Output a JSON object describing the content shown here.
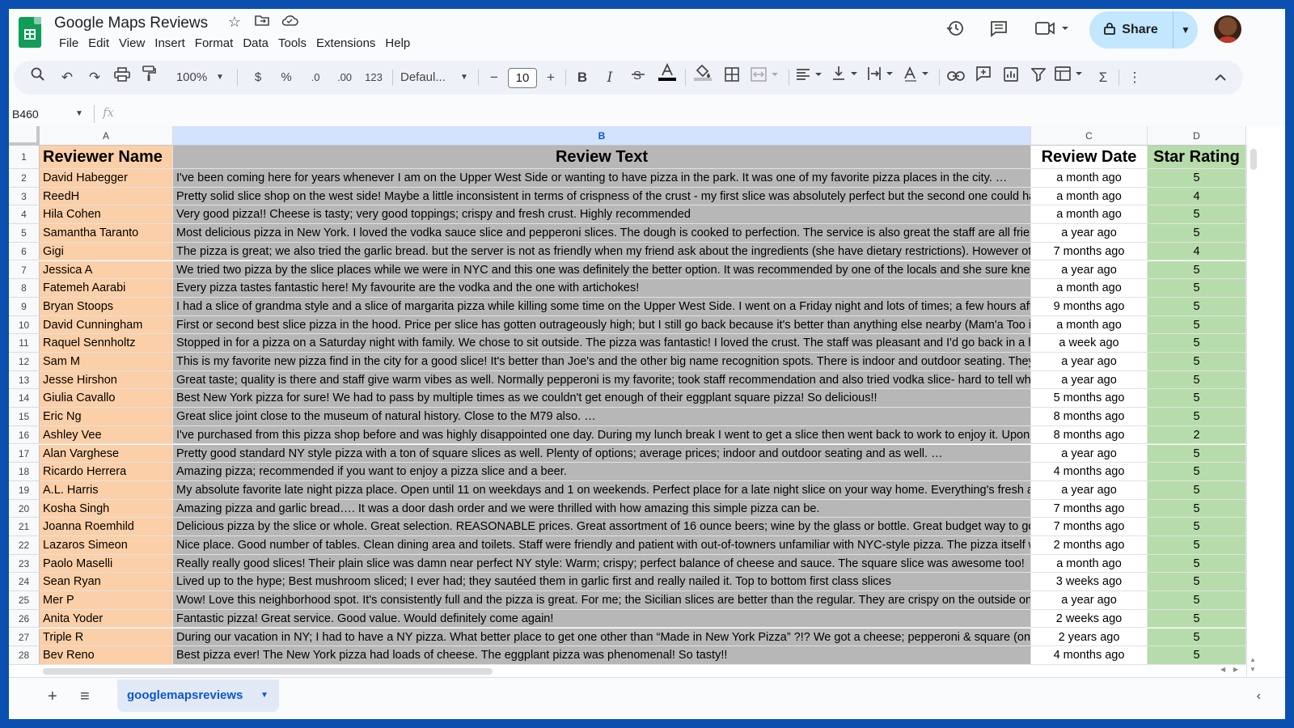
{
  "app": {
    "title": "Google Maps Reviews",
    "menu": [
      "File",
      "Edit",
      "View",
      "Insert",
      "Format",
      "Data",
      "Tools",
      "Extensions",
      "Help"
    ],
    "share_label": "Share",
    "icons": {
      "star": "star-icon",
      "folder": "move-folder-icon",
      "cloud": "cloud-saved-icon",
      "history": "history-icon",
      "comments": "comments-icon",
      "meet": "meet-icon"
    }
  },
  "toolbar": {
    "zoom": "100%",
    "currency": "$",
    "percent": "%",
    "decrease_decimals": ".0",
    "increase_decimals": ".00",
    "number_format": "123",
    "font": "Defaul...",
    "font_size": "10",
    "bold": "B",
    "italic": "I"
  },
  "formula_bar": {
    "cell_ref": "B460",
    "fx": "fx",
    "formula": ""
  },
  "columns": [
    "A",
    "B",
    "C",
    "D"
  ],
  "selected_column": "B",
  "headers": [
    "Reviewer Name",
    "Review Text",
    "Review Date",
    "Star Rating"
  ],
  "rows": [
    [
      "David Habegger",
      "I've been coming here for years whenever I am on the Upper West Side or wanting to have pizza in the park. It was one of my favorite pizza places in the city. …",
      "a month ago",
      "5"
    ],
    [
      "ReedH",
      "Pretty solid slice shop on the west side! Maybe a little inconsistent in terms of crispness of the crust - my first slice was absolutely perfect but the second one could ha",
      "a month ago",
      "4"
    ],
    [
      "Hila Cohen",
      "Very good pizza!! Cheese is tasty; very good toppings; crispy and fresh crust. Highly recommended",
      "a month ago",
      "5"
    ],
    [
      "Samantha Taranto",
      "Most delicious pizza in New York. I loved the vodka sauce slice and pepperoni slices. The dough is cooked to perfection. The service is also great the staff are all frien",
      "a year ago",
      "5"
    ],
    [
      "Gigi",
      "The pizza is great; we also tried the garlic bread. but the server is not as friendly when my friend ask about the ingredients (she have dietary restrictions). However oth",
      "7 months ago",
      "4"
    ],
    [
      "Jessica A",
      "We tried two pizza by the slice places while we were in NYC and this one was definitely the better option. It was recommended by one of the locals and she sure knew",
      "a year ago",
      "5"
    ],
    [
      "Fatemeh Aarabi",
      "Every pizza tastes fantastic here! My favourite are the vodka and the one with artichokes!",
      "a month ago",
      "5"
    ],
    [
      "Bryan Stoops",
      "I had a slice of grandma style and a slice of margarita pizza while killing some time on the Upper West Side. I went on a Friday night and lots of times; a few hours afte",
      "9 months ago",
      "5"
    ],
    [
      "David Cunningham",
      "First or second best slice pizza in the hood.  Price per slice has gotten outrageously high; but I still go back because it's better than anything else nearby (Mam'a Too i",
      "a month ago",
      "5"
    ],
    [
      "Raquel Sennholtz",
      "Stopped in for a pizza on a Saturday night with family. We chose to sit outside. The pizza was fantastic! I loved the crust. The staff was pleasant and I'd go back in a h",
      "a week ago",
      "5"
    ],
    [
      "Sam M",
      "This is my favorite new pizza find in the city for a good slice! It's better than Joe's and the other big name recognition spots. There is indoor and outdoor seating. They",
      "a year ago",
      "5"
    ],
    [
      "Jesse Hirshon",
      "Great taste; quality is there and staff give warm vibes as well. Normally pepperoni is my favorite; took staff recommendation and also tried vodka slice- hard to tell whic",
      "a year ago",
      "5"
    ],
    [
      "Giulia Cavallo",
      "Best New York pizza for sure! We had to pass by multiple times as we couldn't get enough of their eggplant square pizza! So delicious!!",
      "5 months ago",
      "5"
    ],
    [
      "Eric Ng",
      "Great slice joint close to the museum of natural history. Close to the M79 also. …",
      "8 months ago",
      "5"
    ],
    [
      "Ashley Vee",
      "I've purchased from this pizza shop before and was highly disappointed one day. During my lunch break I went to get a slice then went back to work to enjoy it. Upon t",
      "8 months ago",
      "2"
    ],
    [
      "Alan Varghese",
      "Pretty good standard NY style pizza with a ton of square slices as well. Plenty of options; average prices; indoor and outdoor seating and  as well. …",
      "a year ago",
      "5"
    ],
    [
      "Ricardo Herrera",
      "Amazing pizza; recommended if you want to enjoy a pizza slice and a beer.",
      "4 months ago",
      "5"
    ],
    [
      "A.L. Harris",
      "My absolute favorite late night pizza place.  Open until 11 on weekdays and 1 on weekends. Perfect place for a late night slice on your way home.  Everything's fresh a",
      "a year ago",
      "5"
    ],
    [
      "Kosha Singh",
      "Amazing pizza and garlic bread…. It was a door dash order and we were thrilled with how amazing this simple pizza can be.",
      "7 months ago",
      "5"
    ],
    [
      "Joanna Roemhild",
      "Delicious pizza by the slice or whole. Great selection. REASONABLE prices. Great assortment of 16 ounce beers; wine by the glass or bottle. Great budget way to go",
      "7 months ago",
      "5"
    ],
    [
      "Lazaros Simeon",
      "Nice place. Good number of tables. Clean dining area and toilets. Staff were friendly and patient with out-of-towners unfamiliar with NYC-style pizza. The pizza itself w",
      "2 months ago",
      "5"
    ],
    [
      "Paolo Maselli",
      "Really really good slices! Their plain slice was damn near perfect NY style: Warm; crispy; perfect balance of cheese and sauce. The square slice was awesome too!",
      "a month ago",
      "5"
    ],
    [
      "Sean Ryan",
      "Lived up to the hype; Best mushroom sliced; I ever had; they sautéed them in garlic first and really nailed it. Top to bottom first class slices",
      "3 weeks ago",
      "5"
    ],
    [
      "Mer P",
      "Wow! Love this neighborhood spot. It's consistently full and the pizza is great. For me; the Sicilian slices are better than the regular. They are crispy on the outside on",
      "a year ago",
      "5"
    ],
    [
      "Anita Yoder",
      "Fantastic pizza! Great service. Good value. Would definitely come again!",
      "2 weeks ago",
      "5"
    ],
    [
      "Triple R",
      "During our vacation in NY; I had to have a NY pizza. What better place to get one other than “Made in New York Pizza” ?!? We got a cheese; pepperoni & square (onic",
      "2 years ago",
      "5"
    ],
    [
      "Bev Reno",
      "Best pizza ever! The New York pizza had loads of cheese. The eggplant pizza was phenomenal! So tasty!!",
      "4 months ago",
      "5"
    ]
  ],
  "sheet_tab": "googlemapsreviews",
  "colors": {
    "col_a": "#fbcfa7",
    "col_b": "#b7b7b7",
    "col_d": "#b7dcab",
    "accent": "#0b57d0",
    "share_bg": "#c2e7ff"
  }
}
